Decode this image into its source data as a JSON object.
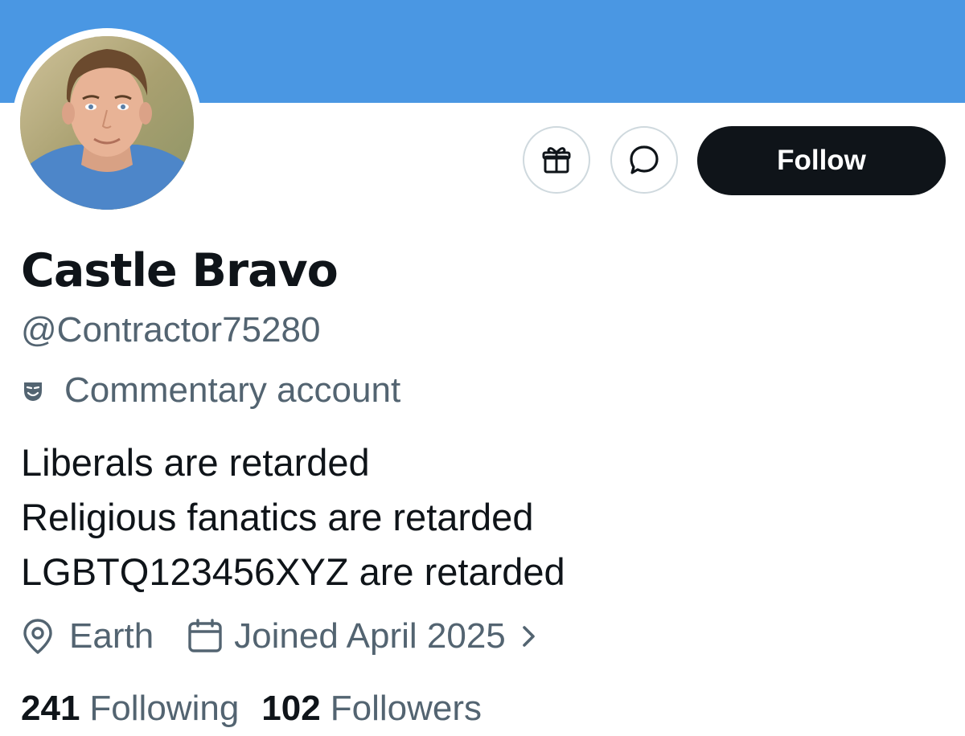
{
  "profile": {
    "display_name": "Castle Bravo",
    "handle": "@Contractor75280",
    "account_label": "Commentary account",
    "bio_lines": [
      "Liberals are retarded",
      "Religious fanatics are retarded",
      "LGBTQ123456XYZ are retarded"
    ],
    "location": "Earth",
    "joined": "Joined April 2025",
    "following_count": "241",
    "following_label": "Following",
    "followers_count": "102",
    "followers_label": "Followers"
  },
  "actions": {
    "follow_label": "Follow",
    "gift_icon": "gift-icon",
    "message_icon": "message-icon"
  },
  "colors": {
    "banner": "#4a97e3",
    "primary_text": "#0f1419",
    "secondary_text": "#536471",
    "follow_button_bg": "#0f1419",
    "button_border": "#cfd9de"
  }
}
